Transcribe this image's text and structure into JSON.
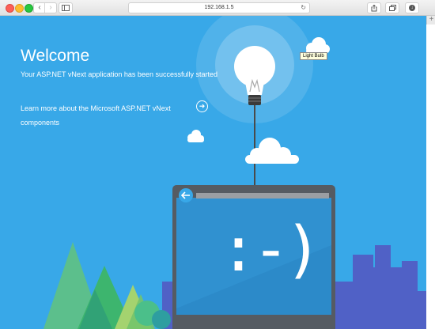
{
  "browser": {
    "url": "192.168.1.5",
    "icons": {
      "back": "chevron-left-icon",
      "forward": "chevron-right-icon",
      "sidebar": "sidebar-icon",
      "reload": "reload-icon",
      "share": "share-icon",
      "tabs": "tabs-overview-icon",
      "downloads": "download-icon",
      "new_tab": "plus-icon"
    }
  },
  "page": {
    "title": "Welcome",
    "subtitle": "Your ASP.NET vNext application has been successfully started",
    "learn_more": "Learn more about the Microsoft ASP.NET vNext components",
    "tooltip": "Light Bulb",
    "smiley": ":-)"
  },
  "colors": {
    "background": "#38a8e8",
    "window_frame": "#555b62",
    "screen": "#2c8ac9",
    "city": "#5061c6"
  }
}
